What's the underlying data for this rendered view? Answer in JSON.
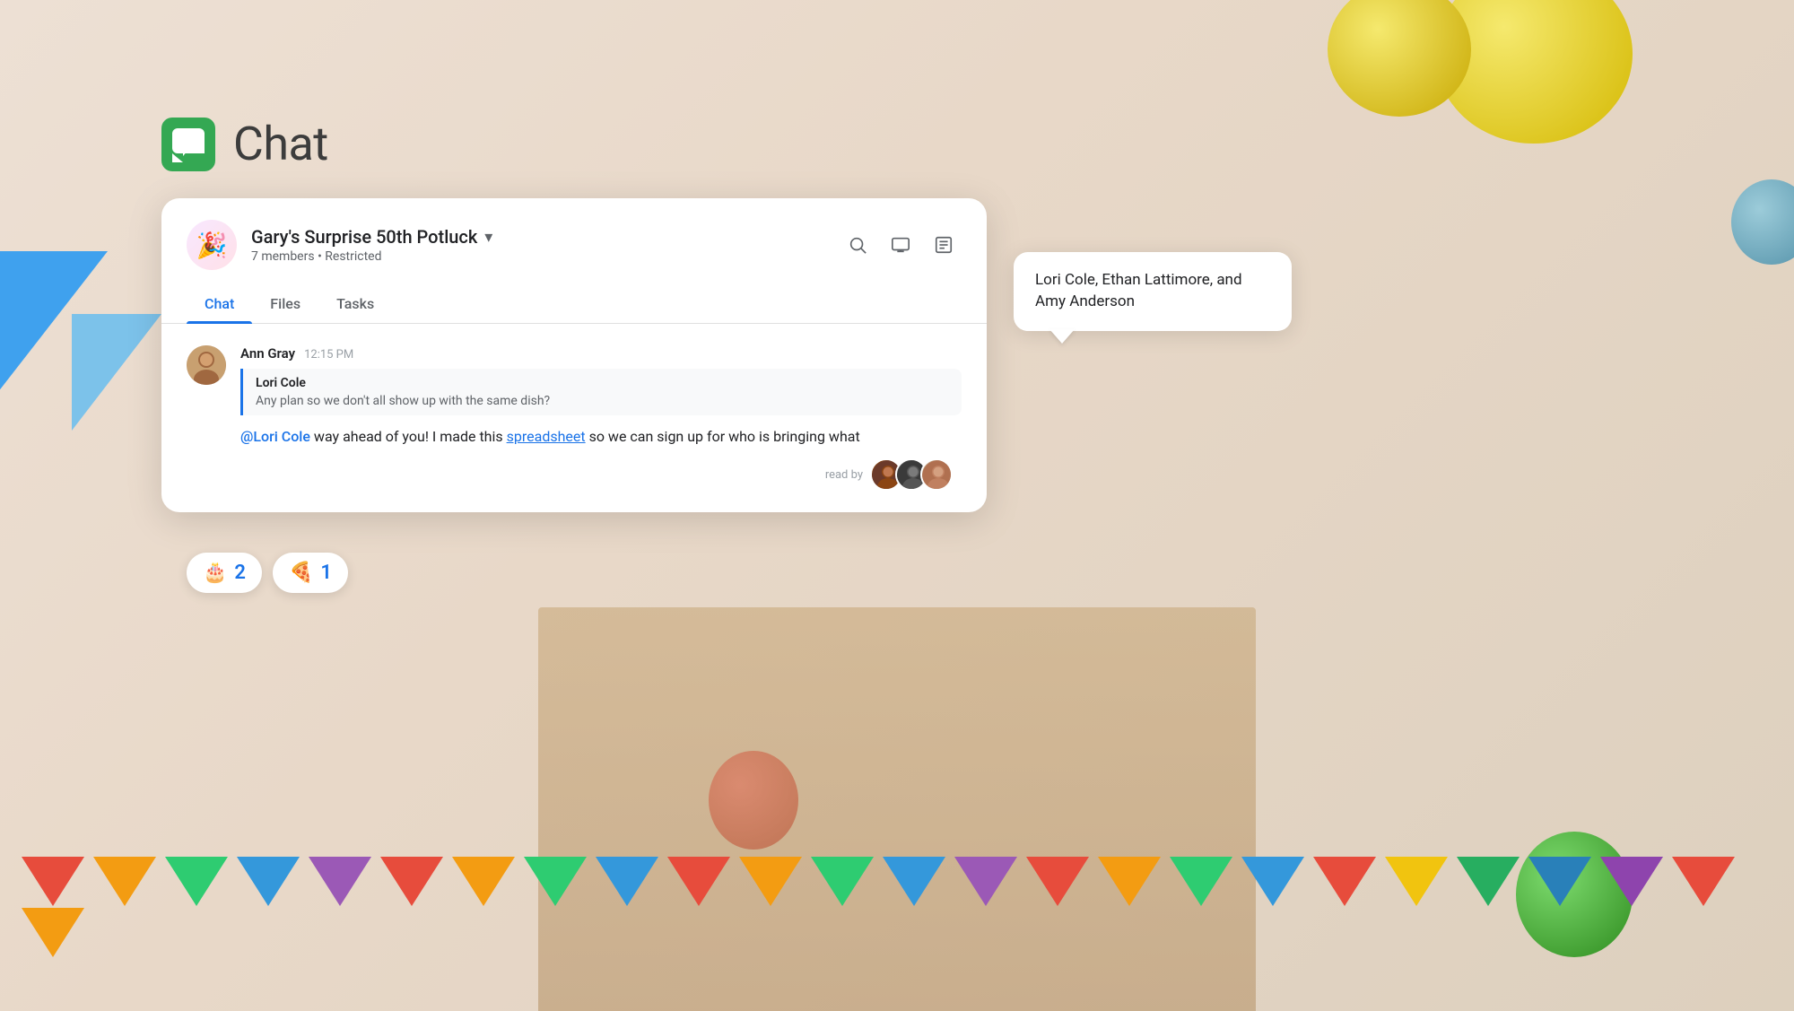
{
  "app": {
    "name": "Chat",
    "logo_color": "#34A853"
  },
  "chat_window": {
    "group_name": "Gary's Surprise 50th Potluck",
    "group_emoji": "🎉",
    "member_count": "7 members",
    "restriction": "Restricted",
    "dropdown_label": "▾",
    "tabs": [
      {
        "id": "chat",
        "label": "Chat",
        "active": true
      },
      {
        "id": "files",
        "label": "Files",
        "active": false
      },
      {
        "id": "tasks",
        "label": "Tasks",
        "active": false
      }
    ],
    "actions": [
      {
        "id": "search",
        "icon": "search"
      },
      {
        "id": "video",
        "icon": "video"
      },
      {
        "id": "more",
        "icon": "more"
      }
    ]
  },
  "message": {
    "author": "Ann Gray",
    "time": "12:15 PM",
    "quoted": {
      "author": "Lori Cole",
      "text": "Any plan so we don't all show up with the same dish?"
    },
    "text_parts": [
      {
        "type": "mention",
        "content": "@Lori Cole"
      },
      {
        "type": "text",
        "content": " way ahead of you! I made this "
      },
      {
        "type": "link",
        "content": "spreadsheet"
      },
      {
        "type": "text",
        "content": " so we can sign up for who is bringing what"
      }
    ],
    "read_by_label": "read by"
  },
  "tooltip": {
    "text": "Lori Cole, Ethan Lattimore, and Amy Anderson"
  },
  "reactions": [
    {
      "emoji": "🎂",
      "count": "2"
    },
    {
      "emoji": "🍕",
      "count": "1"
    }
  ]
}
